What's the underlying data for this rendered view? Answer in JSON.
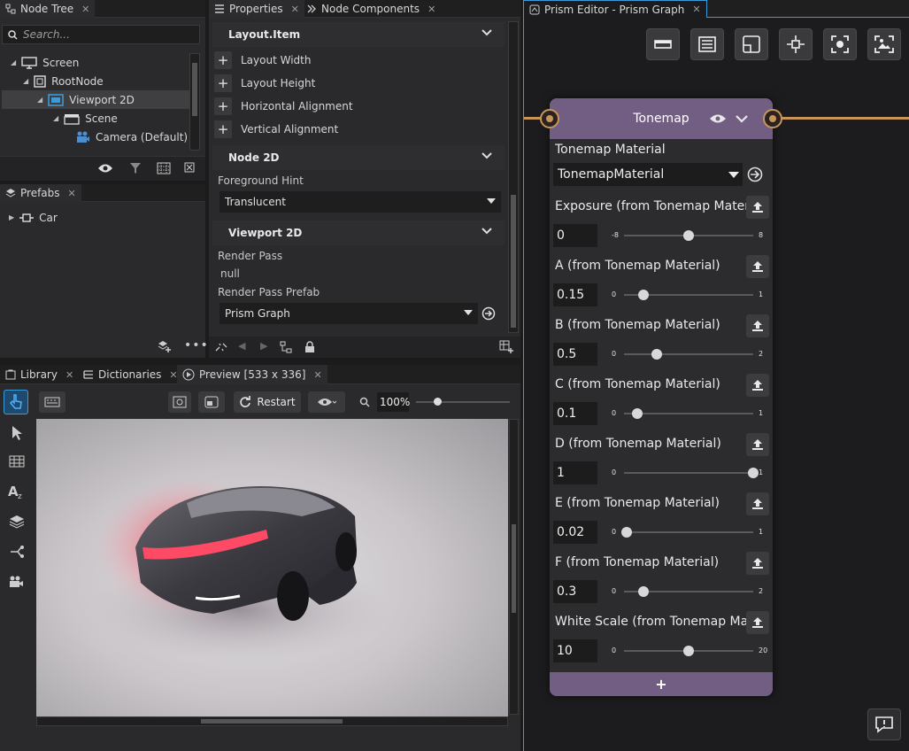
{
  "node_tree": {
    "tab": "Node Tree",
    "search_placeholder": "Search...",
    "items": [
      {
        "label": "Screen"
      },
      {
        "label": "RootNode"
      },
      {
        "label": "Viewport 2D"
      },
      {
        "label": "Scene"
      },
      {
        "label": "Camera (Default)"
      }
    ]
  },
  "prefabs": {
    "tab": "Prefabs",
    "items": [
      {
        "label": "Car"
      }
    ]
  },
  "properties": {
    "tab1": "Properties",
    "tab2": "Node Components",
    "layout_item": {
      "title": "Layout.Item",
      "rows": [
        "Layout Width",
        "Layout Height",
        "Horizontal Alignment",
        "Vertical Alignment"
      ]
    },
    "node2d": {
      "title": "Node 2D",
      "foreground_hint_label": "Foreground Hint",
      "foreground_hint_value": "Translucent"
    },
    "viewport2d": {
      "title": "Viewport 2D",
      "render_pass_label": "Render Pass",
      "render_pass_value": "null",
      "render_pass_prefab_label": "Render Pass Prefab",
      "render_pass_prefab_value": "Prism Graph"
    }
  },
  "bottom_tabs": {
    "library": "Library",
    "dictionaries": "Dictionaries",
    "preview": "Preview [533 x 336]"
  },
  "preview_toolbar": {
    "restart": "Restart",
    "zoom": "100%"
  },
  "prism": {
    "tab": "Prism Editor - Prism Graph",
    "node_title": "Tonemap",
    "material_label": "Tonemap Material",
    "material_value": "TonemapMaterial",
    "params": [
      {
        "label": "Exposure (from Tonemap Material)",
        "value": "0",
        "min": "-8",
        "max": "8",
        "frac": 0.5
      },
      {
        "label": "A (from Tonemap Material)",
        "value": "0.15",
        "min": "0",
        "max": "1",
        "frac": 0.15
      },
      {
        "label": "B (from Tonemap Material)",
        "value": "0.5",
        "min": "0",
        "max": "2",
        "frac": 0.25
      },
      {
        "label": "C (from Tonemap Material)",
        "value": "0.1",
        "min": "0",
        "max": "1",
        "frac": 0.1
      },
      {
        "label": "D (from Tonemap Material)",
        "value": "1",
        "min": "0",
        "max": "1",
        "frac": 1.0
      },
      {
        "label": "E (from Tonemap Material)",
        "value": "0.02",
        "min": "0",
        "max": "1",
        "frac": 0.02
      },
      {
        "label": "F (from Tonemap Material)",
        "value": "0.3",
        "min": "0",
        "max": "2",
        "frac": 0.15
      },
      {
        "label": "White Scale (from Tonemap Material)",
        "value": "10",
        "min": "0",
        "max": "20",
        "frac": 0.5
      }
    ],
    "add_label": "+"
  },
  "colors": {
    "node_header": "#735e83",
    "wire": "#c8955a",
    "accent": "#3a9bd9"
  }
}
